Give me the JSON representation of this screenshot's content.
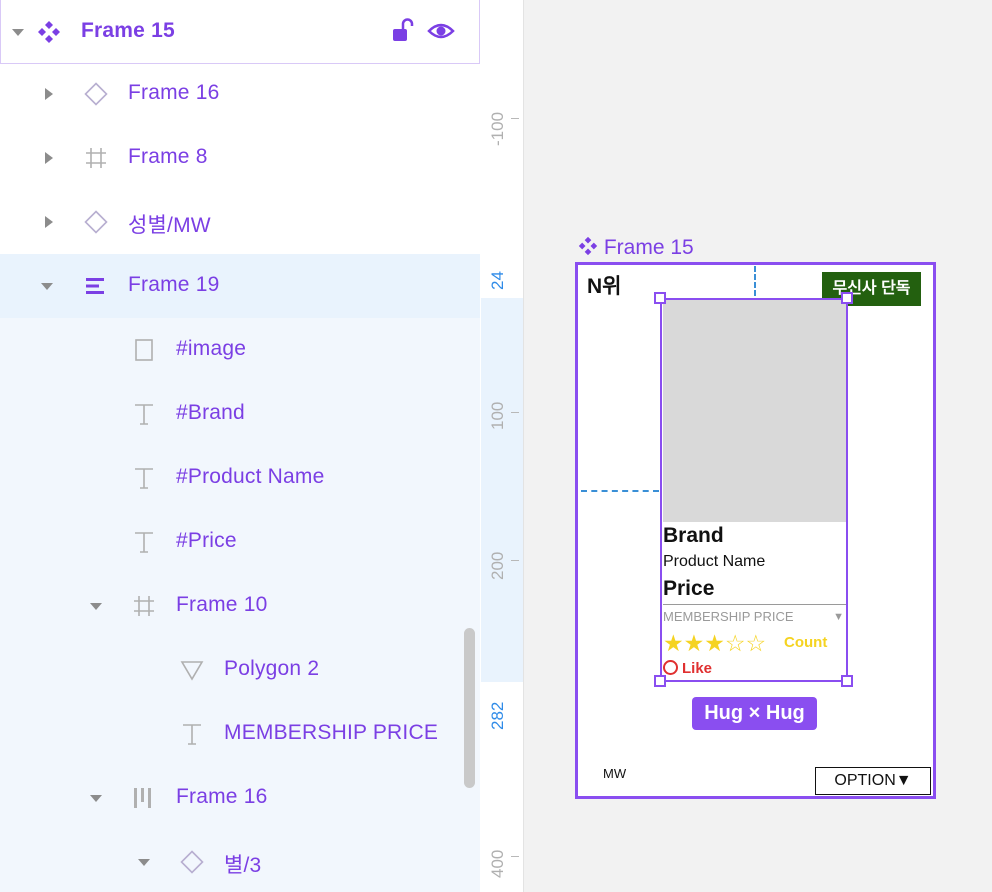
{
  "layers": [
    {
      "id": "frame15",
      "label": "Frame 15",
      "icon": "component-icon",
      "expanded": true
    },
    {
      "id": "frame16a",
      "label": "Frame 16",
      "icon": "diamond-icon",
      "expanded": false
    },
    {
      "id": "frame8",
      "label": "Frame 8",
      "icon": "frame-grid-icon",
      "expanded": false
    },
    {
      "id": "gender",
      "label": "성별/MW",
      "icon": "diamond-icon",
      "expanded": false
    },
    {
      "id": "frame19",
      "label": "Frame 19",
      "icon": "vertical-stack-icon",
      "expanded": true
    },
    {
      "id": "image",
      "label": "#image",
      "icon": "rectangle-icon"
    },
    {
      "id": "brand",
      "label": "#Brand",
      "icon": "text-icon"
    },
    {
      "id": "product",
      "label": "#Product Name",
      "icon": "text-icon"
    },
    {
      "id": "price",
      "label": "#Price",
      "icon": "text-icon"
    },
    {
      "id": "frame10",
      "label": "Frame 10",
      "icon": "frame-grid-icon",
      "expanded": true
    },
    {
      "id": "polygon2",
      "label": "Polygon 2",
      "icon": "triangle-icon"
    },
    {
      "id": "membership",
      "label": "MEMBERSHIP PRICE",
      "icon": "text-icon"
    },
    {
      "id": "frame16b",
      "label": "Frame 16",
      "icon": "horizontal-stack-icon",
      "expanded": true
    },
    {
      "id": "star3",
      "label": "별/3",
      "icon": "diamond-icon",
      "expanded": true
    }
  ],
  "ruler": {
    "labels": [
      "-100",
      "24",
      "100",
      "200",
      "282",
      "400"
    ]
  },
  "canvas": {
    "frame_label": "Frame 15",
    "rank": "N위",
    "exclusive_badge": "무신사 단독",
    "brand": "Brand",
    "product_name": "Product Name",
    "price": "Price",
    "membership": "MEMBERSHIP PRICE",
    "rating": 3,
    "rating_max": 5,
    "count": "Count",
    "like": "Like",
    "size_badge": "Hug × Hug",
    "gender": "MW",
    "option": "OPTION▼"
  },
  "colors": {
    "accent": "#8a4ef0",
    "selection": "#e9f3fd",
    "badge_green": "#23600f",
    "star": "#f5d321",
    "like_red": "#e03030",
    "guide_blue": "#3a8fd6"
  }
}
